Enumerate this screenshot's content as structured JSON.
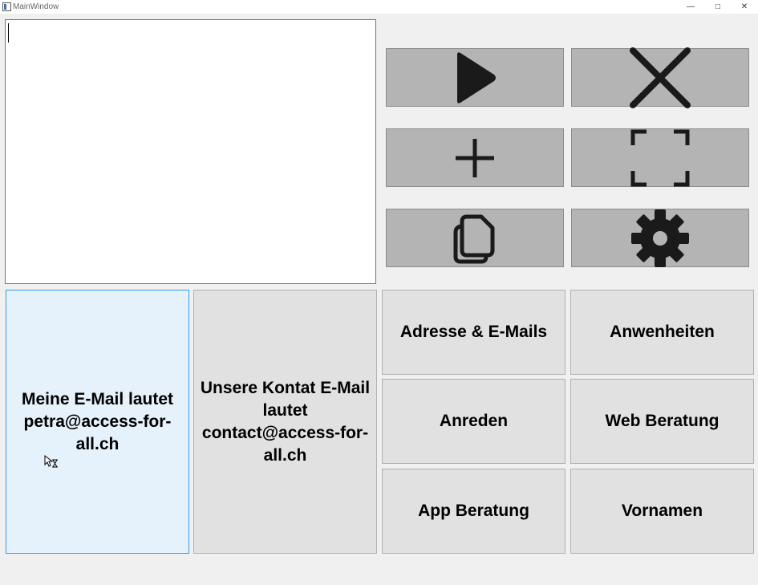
{
  "window": {
    "title": "MainWindow",
    "controls": {
      "minimize": "—",
      "maximize": "□",
      "close": "✕"
    }
  },
  "editor": {
    "value": ""
  },
  "toolbar": [
    {
      "name": "play-button",
      "icon": "play-icon"
    },
    {
      "name": "close-button",
      "icon": "close-icon"
    },
    {
      "name": "add-button",
      "icon": "plus-icon"
    },
    {
      "name": "fullscreen-button",
      "icon": "fullscreen-icon"
    },
    {
      "name": "copy-button",
      "icon": "copy-icon"
    },
    {
      "name": "settings-button",
      "icon": "gear-icon"
    }
  ],
  "phrases": {
    "my_email": "Meine E-Mail lautet petra@access-for-all.ch",
    "our_contact": "Unsere Kontat E-Mail lautet contact@access-for-all.ch"
  },
  "categories": {
    "address_emails": "Adresse & E-Mails",
    "attendance": "Anwenheiten",
    "salutations": "Anreden",
    "web_consulting": "Web Beratung",
    "app_consulting": "App Beratung",
    "first_names": "Vornamen"
  },
  "colors": {
    "icon_button_bg": "#b4b4b4",
    "phrase_button_bg": "#e1e1e1",
    "active_button_bg": "#e5f1fb",
    "focus_border": "#3c7fb1"
  }
}
